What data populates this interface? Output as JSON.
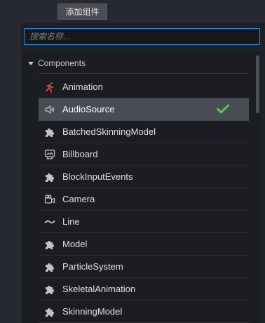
{
  "toolbar": {
    "add_component_label": "添加组件"
  },
  "search": {
    "placeholder": "搜索名称..."
  },
  "group": {
    "label": "Components"
  },
  "items": [
    {
      "label": "Animation",
      "icon": "running-person-icon",
      "selected": false
    },
    {
      "label": "AudioSource",
      "icon": "speaker-icon",
      "selected": true
    },
    {
      "label": "BatchedSkinningModel",
      "icon": "puzzle-icon",
      "selected": false
    },
    {
      "label": "Billboard",
      "icon": "billboard-icon",
      "selected": false
    },
    {
      "label": "BlockInputEvents",
      "icon": "puzzle-icon",
      "selected": false
    },
    {
      "label": "Camera",
      "icon": "camera-icon",
      "selected": false
    },
    {
      "label": "Line",
      "icon": "wave-line-icon",
      "selected": false
    },
    {
      "label": "Model",
      "icon": "puzzle-icon",
      "selected": false
    },
    {
      "label": "ParticleSystem",
      "icon": "puzzle-icon",
      "selected": false
    },
    {
      "label": "SkeletalAnimation",
      "icon": "puzzle-icon",
      "selected": false
    },
    {
      "label": "SkinningModel",
      "icon": "puzzle-icon",
      "selected": false
    }
  ],
  "colors": {
    "accent": "#2f8ed6",
    "check": "#5cc85c",
    "animation_icon": "#e04a4a",
    "selected_bg": "#484c55"
  }
}
